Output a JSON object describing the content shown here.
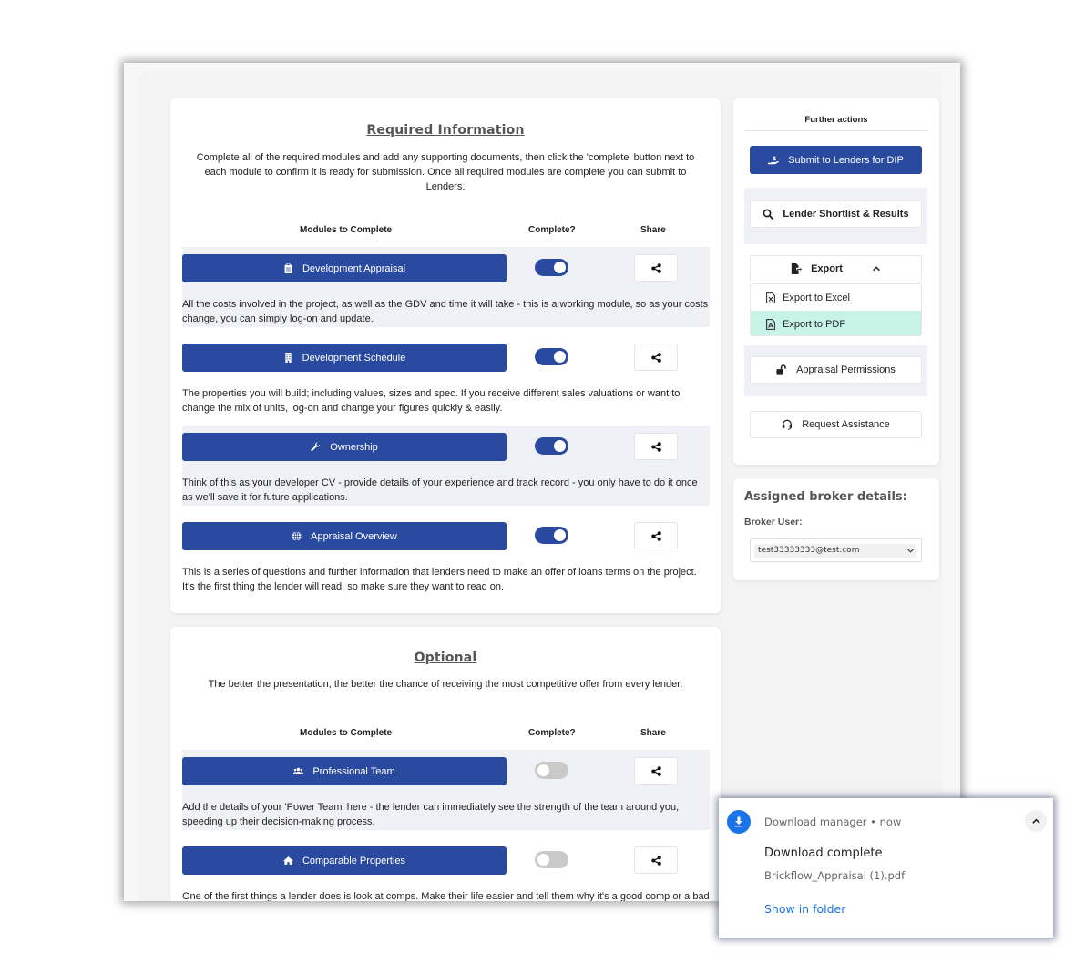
{
  "required": {
    "title": "Required Information",
    "description": "Complete all of the required modules and add any supporting documents, then click the 'complete' button next to each module to confirm it is ready for submission. Once all required modules are complete you can submit to Lenders.",
    "headers": {
      "modules": "Modules to Complete",
      "complete": "Complete?",
      "share": "Share"
    },
    "modules": [
      {
        "label": "Development Appraisal",
        "icon": "clipboard-icon",
        "complete": true,
        "description": "All the costs involved in the project, as well as the GDV and time it will take - this is a working module, so as your costs change, you can simply log-on and update."
      },
      {
        "label": "Development Schedule",
        "icon": "building-icon",
        "complete": true,
        "description": "The properties you will build; including values, sizes and spec. If you receive different sales valuations or want to change the mix of units, log-on and change your figures quickly & easily."
      },
      {
        "label": "Ownership",
        "icon": "wrench-icon",
        "complete": true,
        "description": "Think of this as your developer CV - provide details of your experience and track record - you only have to do it once as we'll save it for future applications."
      },
      {
        "label": "Appraisal Overview",
        "icon": "globe-icon",
        "complete": true,
        "description": "This is a series of questions and further information that lenders need to make an offer of loans terms on the project. It's the first thing the lender will read, so make sure they want to read on."
      }
    ]
  },
  "optional": {
    "title": "Optional",
    "description": "The better the presentation, the better the chance of receiving the most competitive offer from every lender.",
    "headers": {
      "modules": "Modules to Complete",
      "complete": "Complete?",
      "share": "Share"
    },
    "modules": [
      {
        "label": "Professional Team",
        "icon": "users-icon",
        "complete": false,
        "description": "Add the details of your 'Power Team' here - the lender can immediately see the strength of the team around you, speeding up their decision-making process."
      },
      {
        "label": "Comparable Properties",
        "icon": "home-icon",
        "complete": false,
        "description": "One of the first things a lender does is look at comps. Make their life easier and tell them why it's a good comp or a bad comp, by keeping all of your research in one accessible module."
      }
    ]
  },
  "sidebar": {
    "title": "Further actions",
    "submit_label": "Submit to Lenders for DIP",
    "shortlist_label": "Lender Shortlist & Results",
    "export_label": "Export",
    "export_menu": [
      {
        "label": "Export to Excel",
        "icon": "file-excel-icon"
      },
      {
        "label": "Export to PDF",
        "icon": "file-pdf-icon",
        "highlighted": true
      }
    ],
    "permissions_label": "Appraisal Permissions",
    "assistance_label": "Request Assistance"
  },
  "broker": {
    "title": "Assigned broker details:",
    "label": "Broker User:",
    "selected": "test33333333@test.com"
  },
  "notification": {
    "source": "Download manager  •  now",
    "title": "Download complete",
    "filename": "Brickflow_Appraisal (1).pdf",
    "action": "Show in folder"
  },
  "colors": {
    "primary": "#2a4a9f",
    "highlight": "#c7f2e6",
    "link": "#1a73e8"
  }
}
